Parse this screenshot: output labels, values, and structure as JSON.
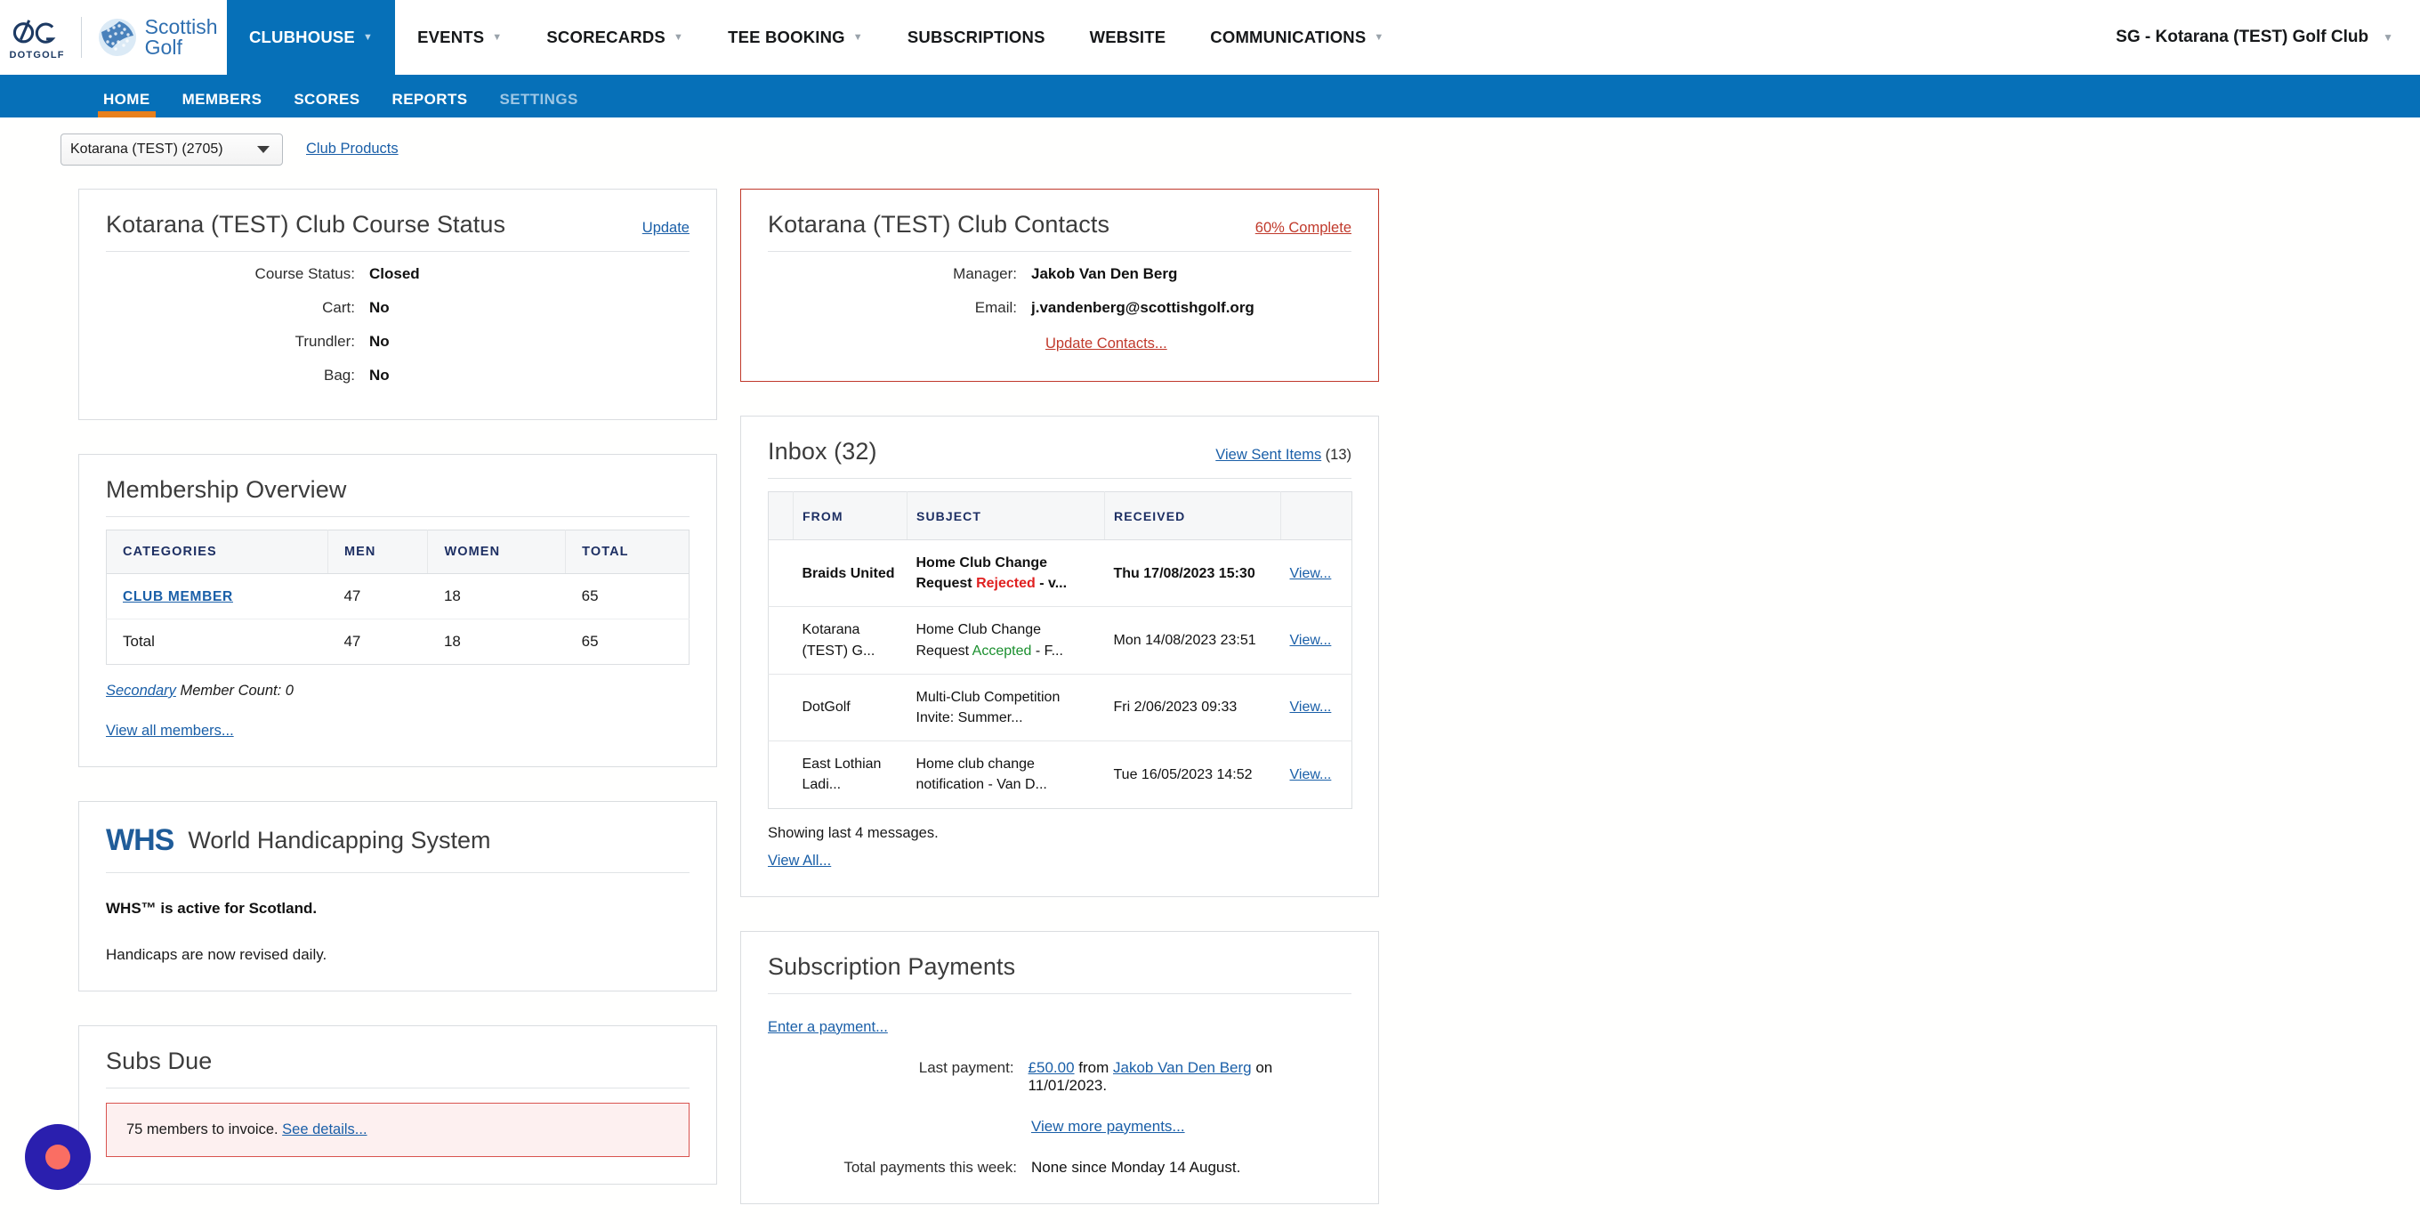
{
  "header": {
    "logo": {
      "dotgolf_word": "DOTGOLF",
      "sg_line1": "Scottish",
      "sg_line2": "Golf"
    },
    "nav": [
      {
        "label": "CLUBHOUSE",
        "caret": "▼",
        "active": true
      },
      {
        "label": "EVENTS",
        "caret": "▼",
        "active": false
      },
      {
        "label": "SCORECARDS",
        "caret": "▼",
        "active": false
      },
      {
        "label": "TEE BOOKING",
        "caret": "▼",
        "active": false
      },
      {
        "label": "SUBSCRIPTIONS",
        "caret": "",
        "active": false
      },
      {
        "label": "WEBSITE",
        "caret": "",
        "active": false
      },
      {
        "label": "COMMUNICATIONS",
        "caret": "▼",
        "active": false
      }
    ],
    "account": {
      "label": "SG - Kotarana (TEST) Golf Club",
      "caret": "▼"
    }
  },
  "subnav": [
    {
      "label": "HOME",
      "active": true,
      "dim": false
    },
    {
      "label": "MEMBERS",
      "active": false,
      "dim": false
    },
    {
      "label": "SCORES",
      "active": false,
      "dim": false
    },
    {
      "label": "REPORTS",
      "active": false,
      "dim": false
    },
    {
      "label": "SETTINGS",
      "active": false,
      "dim": true
    }
  ],
  "toolbar": {
    "club_select_value": "Kotarana (TEST) (2705)",
    "club_products_label": "Club Products"
  },
  "course_status": {
    "title": "Kotarana (TEST) Club Course Status",
    "update_label": "Update",
    "rows": [
      {
        "label": "Course Status:",
        "value": "Closed"
      },
      {
        "label": "Cart:",
        "value": "No"
      },
      {
        "label": "Trundler:",
        "value": "No"
      },
      {
        "label": "Bag:",
        "value": "No"
      }
    ]
  },
  "club_contacts": {
    "title": "Kotarana (TEST) Club Contacts",
    "complete_label": "60% Complete",
    "manager_label": "Manager:",
    "manager_value": "Jakob Van Den Berg",
    "email_label": "Email:",
    "email_value": "j.vandenberg@scottishgolf.org",
    "update_label": "Update Contacts..."
  },
  "membership": {
    "title": "Membership Overview",
    "columns": [
      "CATEGORIES",
      "MEN",
      "WOMEN",
      "TOTAL"
    ],
    "rows": [
      {
        "category": "CLUB MEMBER",
        "men": "47",
        "women": "18",
        "total": "65",
        "link": true
      },
      {
        "category": "Total",
        "men": "47",
        "women": "18",
        "total": "65",
        "link": false
      }
    ],
    "secondary_link": "Secondary",
    "secondary_text": " Member Count: 0",
    "view_all_label": "View all members..."
  },
  "inbox": {
    "title": "Inbox (32)",
    "sent_items_label": "View Sent Items",
    "sent_items_count": "(13)",
    "columns": [
      "",
      "FROM",
      "SUBJECT",
      "RECEIVED",
      ""
    ],
    "rows": [
      {
        "from": "Braids United",
        "subject_pre": "Home Club Change Request ",
        "subject_status": "Rejected",
        "status_kind": "rejected",
        "subject_post": " - v...",
        "received": "Thu 17/08/2023 15:30",
        "action": "View...",
        "unread": true
      },
      {
        "from": "Kotarana (TEST) G...",
        "subject_pre": "Home Club Change Request ",
        "subject_status": "Accepted",
        "status_kind": "accepted",
        "subject_post": " - F...",
        "received": "Mon 14/08/2023 23:51",
        "action": "View...",
        "unread": false
      },
      {
        "from": "DotGolf",
        "subject_pre": "Multi-Club Competition Invite: Summer...",
        "subject_status": "",
        "status_kind": "",
        "subject_post": "",
        "received": "Fri 2/06/2023 09:33",
        "action": "View...",
        "unread": false
      },
      {
        "from": "East Lothian Ladi...",
        "subject_pre": "Home club change notification - Van D...",
        "subject_status": "",
        "status_kind": "",
        "subject_post": "",
        "received": "Tue 16/05/2023 14:52",
        "action": "View...",
        "unread": false
      }
    ],
    "showing_text": "Showing last 4 messages.",
    "view_all_label": "View All..."
  },
  "whs": {
    "logo_text": "WHS",
    "title": "World Handicapping System",
    "active_text": "WHS™ is active for Scotland.",
    "revised_text": "Handicaps are now revised daily."
  },
  "subs_due": {
    "title": "Subs Due",
    "alert_text": "75 members to invoice. ",
    "alert_link": "See details..."
  },
  "subscription_payments": {
    "title": "Subscription Payments",
    "enter_payment_label": "Enter a payment...",
    "last_payment_label": "Last payment:",
    "amount": "£50.00",
    "from_word": " from ",
    "payer": "Jakob Van Den Berg",
    "on_text": " on 11/01/2023.",
    "view_more_label": "View more payments...",
    "total_week_label": "Total payments this week:",
    "total_week_value": "None since Monday 14 August."
  },
  "fab": {
    "name": "chat-widget"
  },
  "colors": {
    "brand_blue": "#0670b8",
    "accent_orange": "#e8801c",
    "link_blue": "#1a5fa8",
    "alert_red": "#c0392b",
    "accepted_green": "#1a8f2e",
    "rejected_red": "#e02020",
    "fab_purple": "#2a1fae",
    "fab_inner": "#fa6e63"
  }
}
